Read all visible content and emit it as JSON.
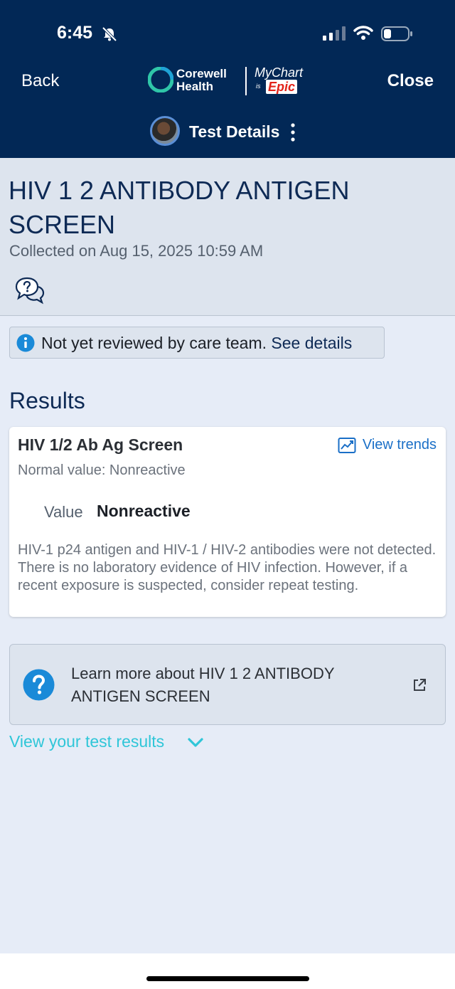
{
  "status_bar": {
    "time": "6:45"
  },
  "header": {
    "back_label": "Back",
    "close_label": "Close",
    "brand": {
      "corewell_line1": "Corewell",
      "corewell_line2": "Health",
      "mychart": "MyChart",
      "is": "is",
      "epic": "Epic"
    },
    "page_title": "Test Details"
  },
  "test": {
    "title": "HIV 1 2 ANTIBODY ANTIGEN SCREEN",
    "collected": "Collected on Aug 15, 2025 10:59 AM"
  },
  "notice": {
    "text": "Not yet reviewed by care team.",
    "link": "See details"
  },
  "results": {
    "heading": "Results",
    "card": {
      "title": "HIV 1/2 Ab Ag Screen",
      "trends_label": "View trends",
      "normal_value": "Normal value: Nonreactive",
      "value_label": "Value",
      "value": "Nonreactive",
      "comment": "HIV-1 p24 antigen and HIV-1 / HIV-2 antibodies were not detected. There is no laboratory evidence of HIV infection. However, if a recent exposure is suspected, consider repeat testing."
    }
  },
  "learn_more": {
    "text": "Learn more about HIV 1 2 ANTIBODY ANTIGEN SCREEN"
  },
  "view_results_label": "View your test results",
  "colors": {
    "header_bg": "#022856",
    "accent_link": "#1a6fc7",
    "teal_link": "#2fc6d8",
    "epic_red": "#e2231a"
  }
}
